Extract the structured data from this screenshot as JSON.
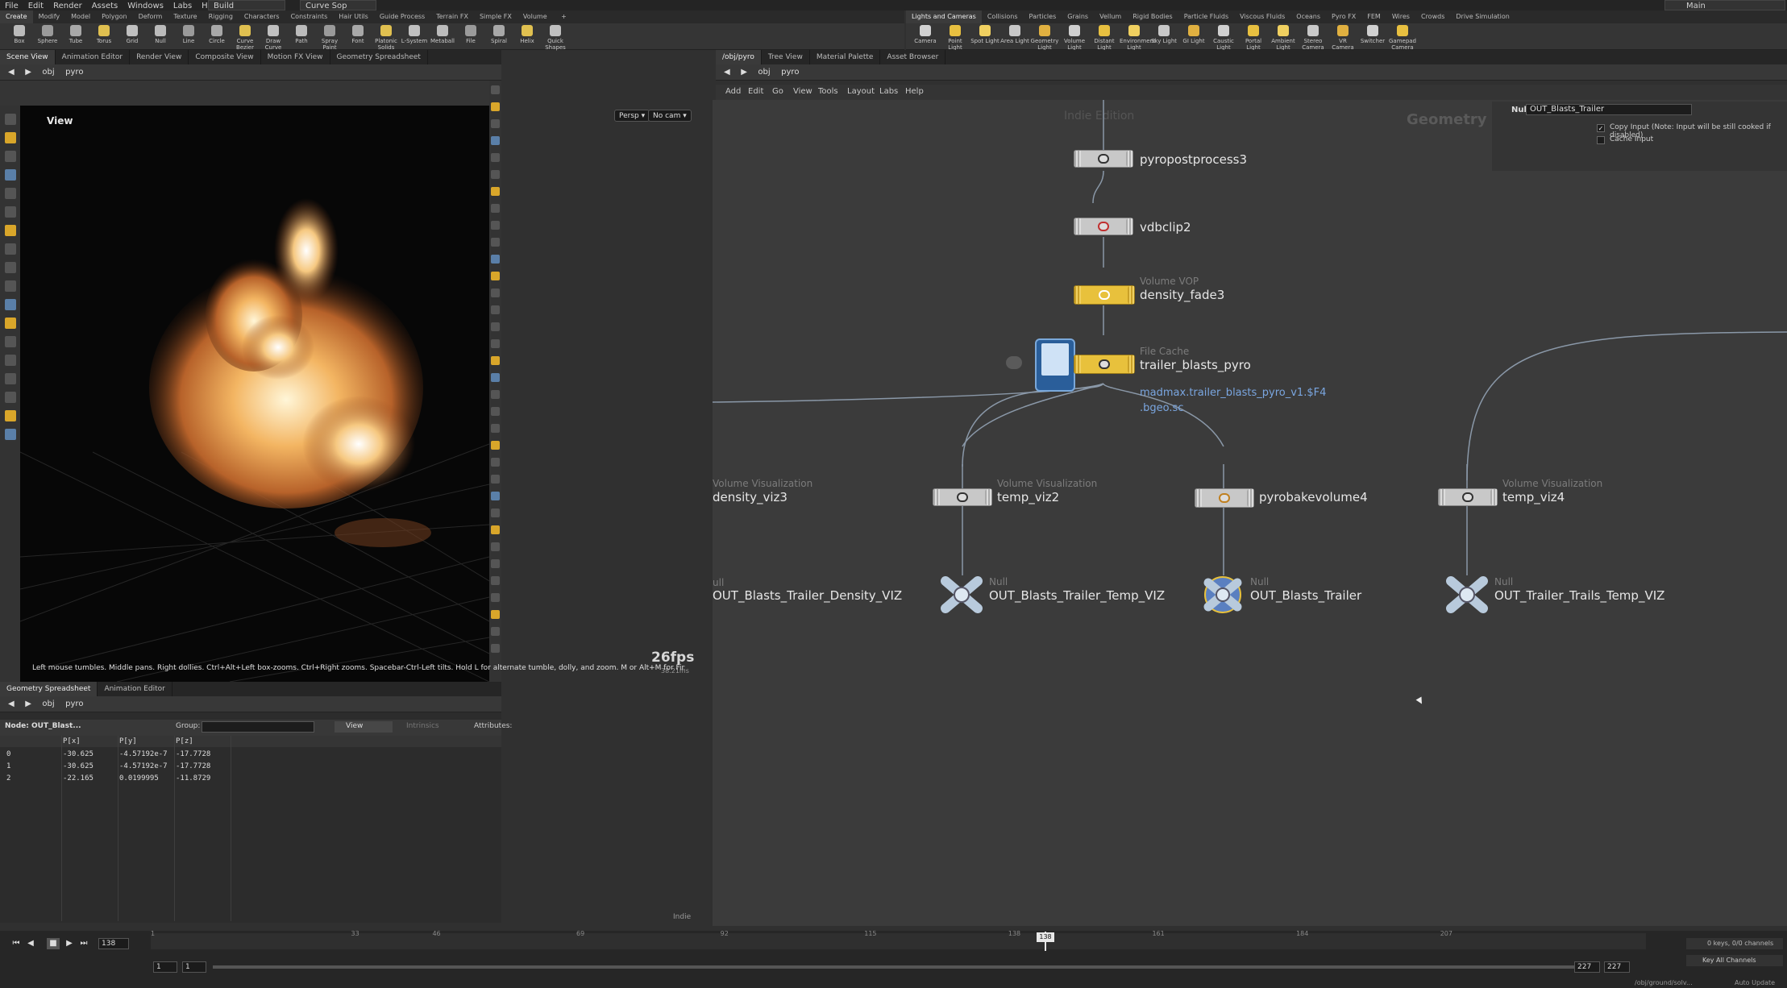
{
  "menubar": {
    "items": [
      "File",
      "Edit",
      "Render",
      "Assets",
      "Windows",
      "Labs",
      "Help"
    ],
    "desktop": "Build",
    "context": "Curve Sop",
    "desktop_right": "Main"
  },
  "shelf_left": {
    "tabs": [
      "Create",
      "Modify",
      "Model",
      "Polygon",
      "Deform",
      "Texture",
      "Rigging",
      "Characters",
      "Constraints",
      "Hair Utils",
      "Guide Process",
      "Terrain FX",
      "Simple FX",
      "Volume"
    ],
    "tools": [
      "Box",
      "Sphere",
      "Tube",
      "Torus",
      "Grid",
      "Null",
      "Line",
      "Circle",
      "Curve Bezier",
      "Draw Curve",
      "Path",
      "Spray Paint",
      "Font",
      "Platonic Solids",
      "L-System",
      "Metaball",
      "File",
      "Spiral",
      "Helix",
      "Quick Shapes"
    ]
  },
  "shelf_right": {
    "tabs": [
      "Lights and Cameras",
      "Collisions",
      "Particles",
      "Grains",
      "Vellum",
      "Rigid Bodies",
      "Particle Fluids",
      "Viscous Fluids",
      "Oceans",
      "Pyro FX",
      "FEM",
      "Wires",
      "Crowds",
      "Drive Simulation"
    ],
    "tools": [
      "Camera",
      "Point Light",
      "Spot Light",
      "Area Light",
      "Geometry Light",
      "Volume Light",
      "Distant Light",
      "Environment Light",
      "Sky Light",
      "GI Light",
      "Caustic Light",
      "Portal Light",
      "Ambient Light",
      "Stereo Camera",
      "VR Camera",
      "Switcher",
      "Gamepad Camera"
    ]
  },
  "left_pane": {
    "tabs": [
      "Scene View",
      "Animation Editor",
      "Render View",
      "Composite View",
      "Motion FX View",
      "Geometry Spreadsheet"
    ],
    "path": [
      "obj",
      "pyro"
    ],
    "viewport_title": "View",
    "persp": "Persp",
    "cam": "No cam",
    "fps": "26fps",
    "ms": "38.21ms",
    "hint": "Left mouse tumbles. Middle pans. Right dollies. Ctrl+Alt+Left box-zooms. Ctrl+Right zooms. Spacebar-Ctrl-Left tilts. Hold L for alternate tumble, dolly, and zoom. M or Alt+M for First Person N..."
  },
  "spreadsheet": {
    "tabs": [
      "Geometry Spreadsheet",
      "Animation Editor"
    ],
    "path": [
      "obj",
      "pyro"
    ],
    "node_label": "Node: OUT_Blast...",
    "group_label": "Group:",
    "view_label": "View",
    "intrinsics_label": "Intrinsics",
    "attributes_label": "Attributes:",
    "columns": [
      "P[x]",
      "P[y]",
      "P[z]"
    ],
    "rows": [
      {
        "idx": "0",
        "x": "-30.625",
        "y": "-4.57192e-7",
        "z": "-17.7728"
      },
      {
        "idx": "1",
        "x": "-30.625",
        "y": "-4.57192e-7",
        "z": "-17.7728"
      },
      {
        "idx": "2",
        "x": "-22.165",
        "y": "0.0199995",
        "z": "-11.8729"
      }
    ],
    "footer": "Indie"
  },
  "right_pane": {
    "tabs": [
      "/obj/pyro",
      "Tree View",
      "Material Palette",
      "Asset Browser"
    ],
    "path": [
      "obj",
      "pyro"
    ],
    "menu": [
      "Add",
      "Edit",
      "Go",
      "View",
      "Tools",
      "Layout",
      "Labs",
      "Help"
    ],
    "watermark": "Indie Edition",
    "context_label": "Geometry"
  },
  "params": {
    "type": "Null",
    "name": "OUT_Blasts_Trailer",
    "copy_input": "Copy Input (Note: Input will be still cooked if disabled)",
    "cache_input": "Cache Input"
  },
  "nodes": {
    "n1": {
      "name": "pyropostprocess3"
    },
    "n2": {
      "name": "vdbclip2"
    },
    "n3": {
      "type": "Volume VOP",
      "name": "density_fade3"
    },
    "n4": {
      "type": "File Cache",
      "name": "trailer_blasts_pyro",
      "link1": "madmax.trailer_blasts_pyro_v1.$F4",
      "link2": ".bgeo.sc"
    },
    "n5": {
      "type": "Volume Visualization",
      "name": "density_viz3"
    },
    "n6": {
      "type": "Volume Visualization",
      "name": "temp_viz2"
    },
    "n7": {
      "name": "pyrobakevolume4"
    },
    "n8": {
      "type": "Volume Visualization",
      "name": "temp_viz4"
    },
    "n9": {
      "type": "ull",
      "name": "OUT_Blasts_Trailer_Density_VIZ"
    },
    "n10": {
      "type": "Null",
      "name": "OUT_Blasts_Trailer_Temp_VIZ"
    },
    "n11": {
      "type": "Null",
      "name": "OUT_Blasts_Trailer"
    },
    "n12": {
      "type": "Null",
      "name": "OUT_Trailer_Trails_Temp_VIZ"
    }
  },
  "timeline": {
    "current_frame": "138",
    "ticks": [
      "1",
      "33",
      "46",
      "69",
      "92",
      "115",
      "138",
      "161",
      "184",
      "207"
    ],
    "start": "1",
    "start2": "1",
    "end": "227",
    "end2": "227",
    "keys": "0 keys, 0/0 channels",
    "key_all": "Key All Channels",
    "status_path": "/obj/ground/solv...",
    "auto_update": "Auto Update"
  }
}
